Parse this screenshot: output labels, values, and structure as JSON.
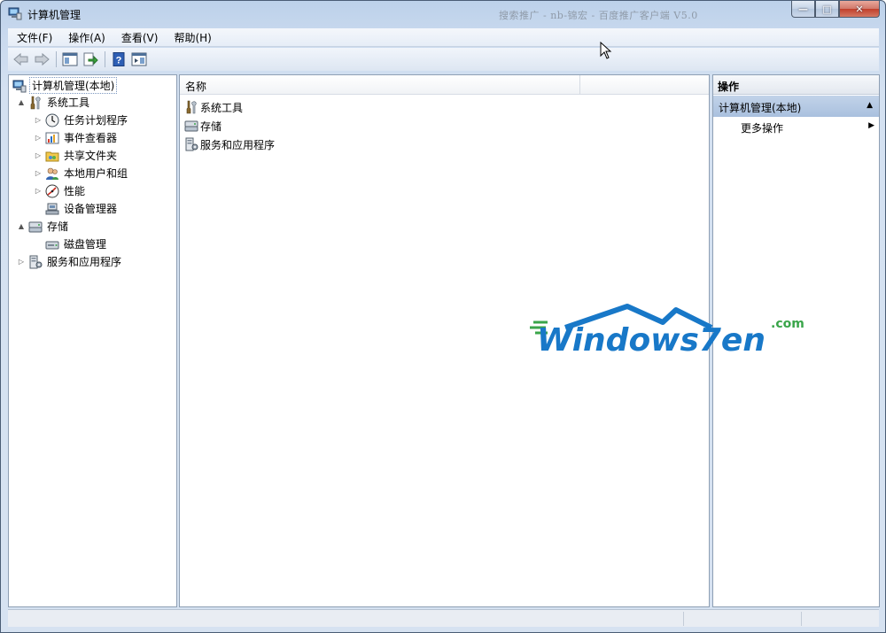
{
  "window": {
    "title": "计算机管理",
    "ghost_title": "搜索推广 - nb-锦宏 - 百度推广客户端 V5.0",
    "buttons": {
      "minimize": "—",
      "maximize": "□",
      "close": "✕"
    }
  },
  "menubar": {
    "items": [
      "文件(F)",
      "操作(A)",
      "查看(V)",
      "帮助(H)"
    ]
  },
  "toolbar": {
    "icons": [
      "back-arrow-icon",
      "forward-arrow-icon",
      "show-hide-console-tree-icon",
      "export-list-icon",
      "help-icon",
      "show-hide-action-pane-icon"
    ]
  },
  "tree": {
    "root": "计算机管理(本地)",
    "items": [
      {
        "label": "系统工具",
        "expand": "▲",
        "icon": "tools-icon"
      },
      {
        "label": "任务计划程序",
        "expand": "▷",
        "icon": "clock-icon"
      },
      {
        "label": "事件查看器",
        "expand": "▷",
        "icon": "event-viewer-icon"
      },
      {
        "label": "共享文件夹",
        "expand": "▷",
        "icon": "shared-folder-icon"
      },
      {
        "label": "本地用户和组",
        "expand": "▷",
        "icon": "users-icon"
      },
      {
        "label": "性能",
        "expand": "▷",
        "icon": "performance-icon"
      },
      {
        "label": "设备管理器",
        "expand": "",
        "icon": "device-manager-icon"
      },
      {
        "label": "存储",
        "expand": "▲",
        "icon": "storage-icon"
      },
      {
        "label": "磁盘管理",
        "expand": "",
        "icon": "disk-icon"
      },
      {
        "label": "服务和应用程序",
        "expand": "▷",
        "icon": "services-icon"
      }
    ]
  },
  "list": {
    "column_header": "名称",
    "rows": [
      "系统工具",
      "存储",
      "服务和应用程序"
    ]
  },
  "actions": {
    "header": "操作",
    "group": "计算机管理(本地)",
    "group_arrow": "▲",
    "item": "更多操作",
    "item_arrow": "▶"
  },
  "watermark": {
    "main": "Windows7en",
    "suffix": ".com"
  },
  "colors": {
    "accent": "#1e6fbf",
    "watermark_blue": "#1878c8",
    "watermark_green": "#3aa54a"
  }
}
